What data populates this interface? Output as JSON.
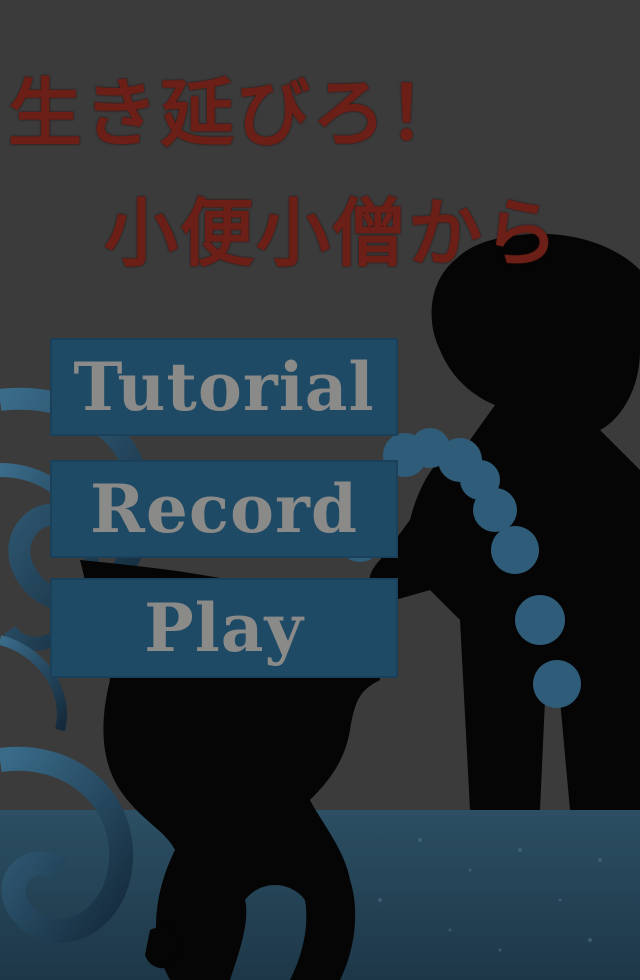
{
  "title": {
    "line1": "生き延びろ！",
    "line2": "小便小僧から"
  },
  "menu": {
    "tutorial_label": "Tutorial",
    "record_label": "Record",
    "play_label": "Play"
  },
  "colors": {
    "title_text": "#6b1f17",
    "button_bg": "#1f4a66",
    "button_text": "#8a8a88",
    "overlay_bg": "#3b3b3b",
    "water_floor": "#2a4a5e"
  }
}
